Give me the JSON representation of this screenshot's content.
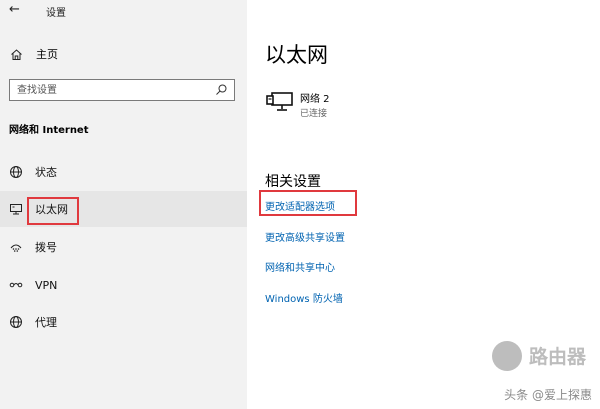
{
  "window": {
    "back_glyph": "←",
    "title": "设置"
  },
  "sidebar": {
    "home_label": "主页",
    "search_placeholder": "查找设置",
    "section_title": "网络和 Internet",
    "items": [
      {
        "label": "状态",
        "icon": "status-globe-icon"
      },
      {
        "label": "以太网",
        "icon": "ethernet-icon",
        "selected": true
      },
      {
        "label": "拨号",
        "icon": "dialup-icon"
      },
      {
        "label": "VPN",
        "icon": "vpn-icon"
      },
      {
        "label": "代理",
        "icon": "proxy-globe-icon"
      }
    ]
  },
  "main": {
    "page_title": "以太网",
    "network": {
      "name": "网络 2",
      "status": "已连接",
      "icon": "ethernet-monitor-icon"
    },
    "related_title": "相关设置",
    "links": [
      "更改适配器选项",
      "更改高级共享设置",
      "网络和共享中心",
      "Windows 防火墙"
    ]
  },
  "watermark": {
    "brand": "路由器",
    "credit": "头条 @爱上探惠"
  },
  "colors": {
    "sidebar_bg": "#f2f2f2",
    "link": "#0063b1",
    "highlight_box": "#e0393e",
    "selected_bg": "#e6e6e6"
  }
}
